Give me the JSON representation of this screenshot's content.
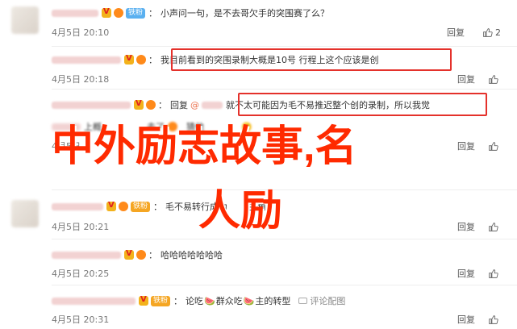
{
  "comments": [
    {
      "badge_label": "铁粉",
      "colon": "：",
      "text": "小声问一句，是不去哥欠手的突围赛了么？",
      "date": "4月5日 20:10",
      "reply_label": "回复",
      "like_count": "2"
    },
    {
      "colon": "：",
      "text": "我目前看到的突围录制大概是10号 行程上这个应该是创",
      "date": "4月5日 20:18",
      "reply_label": "回复"
    },
    {
      "colon": "：",
      "reply_word": "回复",
      "at": "@",
      "text": "就不太可能因为毛不易推迟整个创的录制，所以我觉",
      "date": "4月5日",
      "reply_label": "回复"
    },
    {
      "partial_text": "上概",
      "partial_text_2": "去了",
      "partial_text_3": "猜他",
      "date": "4月5日",
      "reply_label": "回复"
    },
    {
      "badge_label": "铁粉",
      "colon": "：",
      "text": "毛不易转行成为",
      "tail_text": "主角",
      "date": "4月5日 20:21",
      "reply_label": "回复"
    },
    {
      "colon": "：",
      "text": "哈哈哈哈哈哈哈",
      "date": "4月5日 20:25",
      "reply_label": "回复"
    },
    {
      "badge_label": "铁粉",
      "colon": "：",
      "text_a": "论吃",
      "text_b": "群众吃",
      "text_c": "主的转型",
      "report_label": "评论配图",
      "date": "4月5日 20:31",
      "reply_label": "回复"
    }
  ],
  "overlay": {
    "line1": "中外励志故事,名",
    "line2": "人励"
  },
  "colors": {
    "overlay_red": "#ff2a00",
    "highlight_box": "#e4312b",
    "mention": "#eb7350"
  }
}
